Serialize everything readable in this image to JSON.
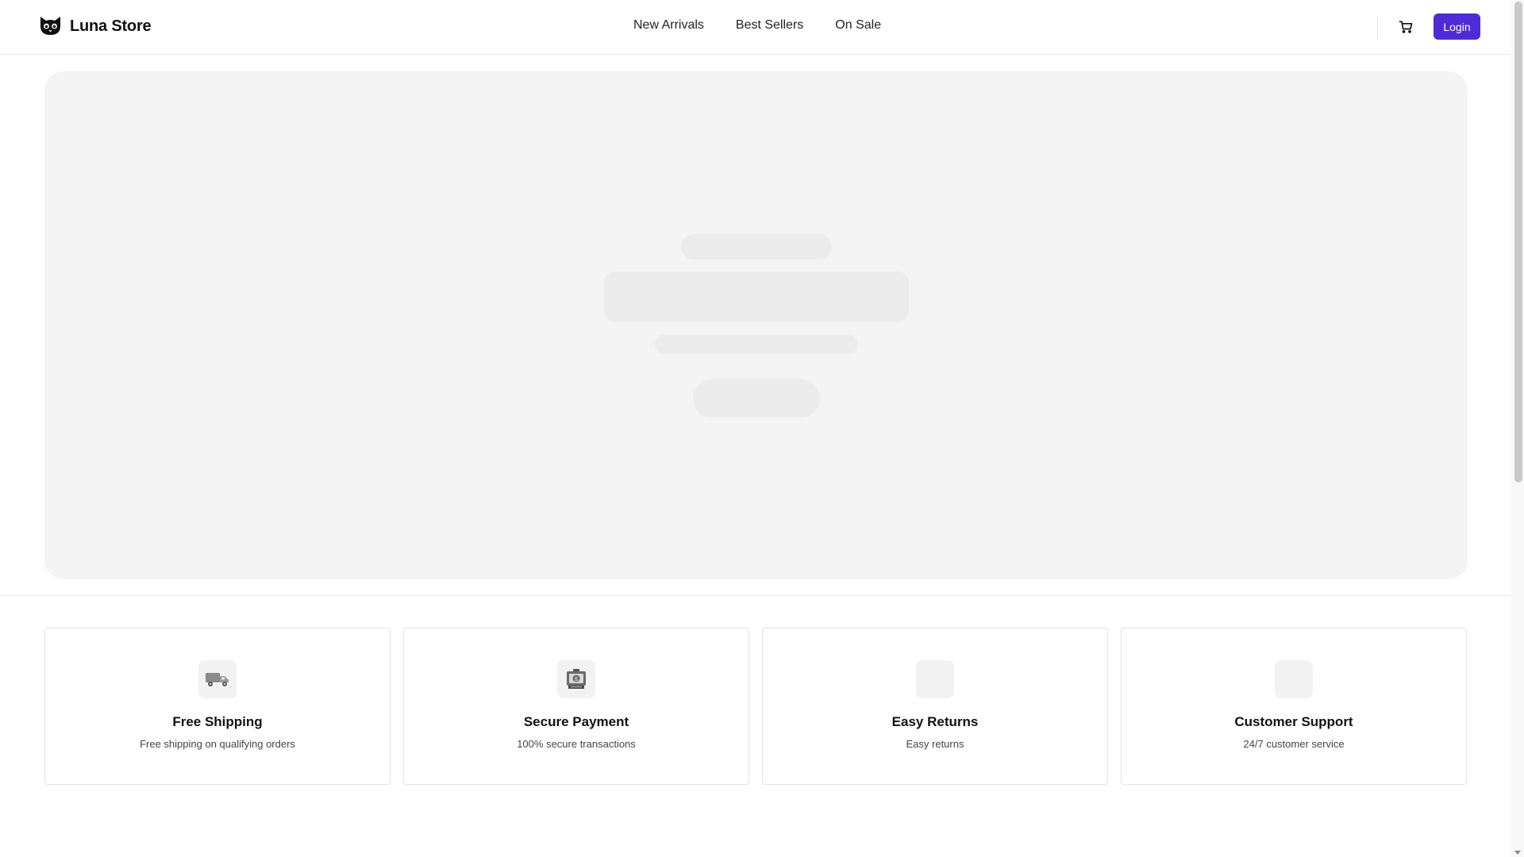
{
  "header": {
    "brand": "Luna Store",
    "nav": [
      "New Arrivals",
      "Best Sellers",
      "On Sale"
    ],
    "login_label": "Login",
    "accent_color": "#4f2bd8"
  },
  "hero": {
    "state": "loading-skeleton"
  },
  "features": [
    {
      "icon": "truck-icon",
      "title": "Free Shipping",
      "desc": "Free shipping on qualifying orders"
    },
    {
      "icon": "payment-icon",
      "title": "Secure Payment",
      "desc": "100% secure transactions"
    },
    {
      "icon": "returns-icon",
      "title": "Easy Returns",
      "desc": "Easy returns"
    },
    {
      "icon": "support-icon",
      "title": "Customer Support",
      "desc": "24/7 customer service"
    }
  ]
}
